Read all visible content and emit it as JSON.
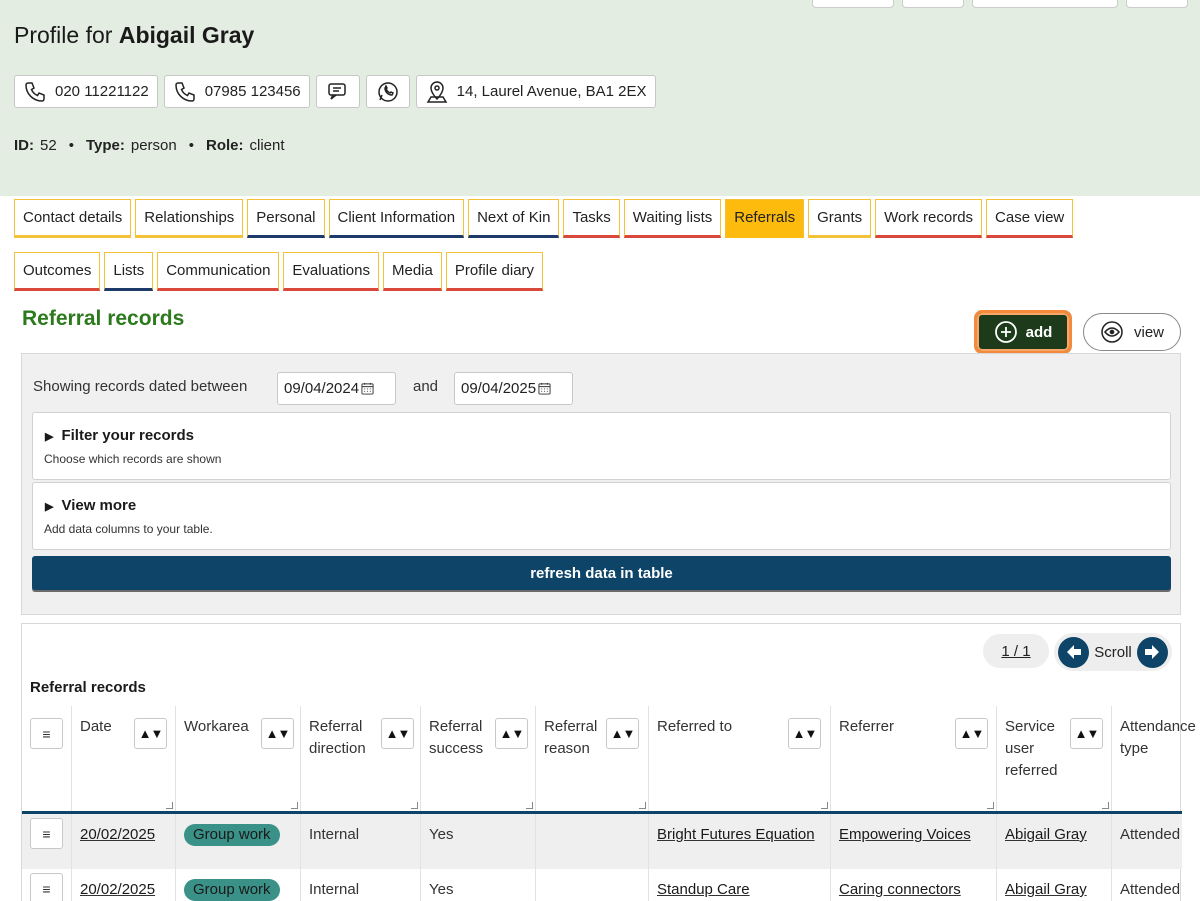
{
  "profile": {
    "title_prefix": "Profile for",
    "name": "Abigail Gray"
  },
  "contacts": {
    "phone1": "020 11221122",
    "phone2": "07985 123456",
    "address": "14, Laurel Avenue, BA1 2EX"
  },
  "meta": {
    "id_label": "ID:",
    "id_value": "52",
    "type_label": "Type:",
    "type_value": "person",
    "role_label": "Role:",
    "role_value": "client",
    "separator": "•"
  },
  "tabs_row1": [
    {
      "label": "Contact details",
      "underline": "#f3c238"
    },
    {
      "label": "Relationships",
      "underline": "#f3c238"
    },
    {
      "label": "Personal",
      "underline": "#1d3b6a"
    },
    {
      "label": "Client Information",
      "underline": "#1d3b6a"
    },
    {
      "label": "Next of Kin",
      "underline": "#1d3b6a"
    },
    {
      "label": "Tasks",
      "underline": "#d9483b"
    },
    {
      "label": "Waiting lists",
      "underline": "#d9483b"
    },
    {
      "label": "Referrals",
      "underline": "#fdbb0e"
    },
    {
      "label": "Grants",
      "underline": "#f3c238"
    },
    {
      "label": "Work records",
      "underline": "#d9483b"
    },
    {
      "label": "Case view",
      "underline": "#d9483b"
    }
  ],
  "tabs_row2": [
    {
      "label": "Outcomes",
      "underline": "#d9483b"
    },
    {
      "label": "Lists",
      "underline": "#1d3b6a"
    },
    {
      "label": "Communication",
      "underline": "#d9483b"
    },
    {
      "label": "Evaluations",
      "underline": "#d9483b"
    },
    {
      "label": "Media",
      "underline": "#d9483b"
    },
    {
      "label": "Profile diary",
      "underline": "#d9483b"
    }
  ],
  "section": {
    "title": "Referral records",
    "add_label": "add",
    "view_label": "view"
  },
  "filters": {
    "showing_label": "Showing records dated between",
    "date_from": "09/04/2024",
    "and_label": "and",
    "date_to": "09/04/2025",
    "filter_title": "Filter your records",
    "filter_sub": "Choose which records are shown",
    "viewmore_title": "View more",
    "viewmore_sub": "Add data columns to your table.",
    "refresh_label": "refresh data in table"
  },
  "table": {
    "pager": "1 / 1",
    "scroll_label": "Scroll",
    "caption": "Referral records",
    "menu_glyph": "≡",
    "sort_glyph": "▲▼",
    "headers": [
      "Date",
      "Workarea",
      "Referral direction",
      "Referral success",
      "Referral reason",
      "Referred to",
      "Referrer",
      "Service user referred",
      "Attendance type"
    ],
    "rows": [
      {
        "date": "20/02/2025",
        "workarea": "Group work",
        "direction": "Internal",
        "success": "Yes",
        "reason": "",
        "referred_to": "Bright Futures Equation",
        "referrer": "Empowering Voices",
        "service_user": "Abigail Gray",
        "attendance": "Attended"
      },
      {
        "date": "20/02/2025",
        "workarea": "Group work",
        "direction": "Internal",
        "success": "Yes",
        "reason": "",
        "referred_to": "Standup Care",
        "referrer": "Caring connectors",
        "service_user": "Abigail Gray",
        "attendance": "Attended"
      }
    ]
  },
  "colors": {
    "header_bg": "#e4ede2",
    "active_tab": "#fdbb0e",
    "section_title": "#2c7a1d",
    "add_button": "#1d3b1a",
    "add_highlight": "#f58a3c",
    "refresh_bg": "#0d4468",
    "pill_bg": "#3a9188"
  }
}
